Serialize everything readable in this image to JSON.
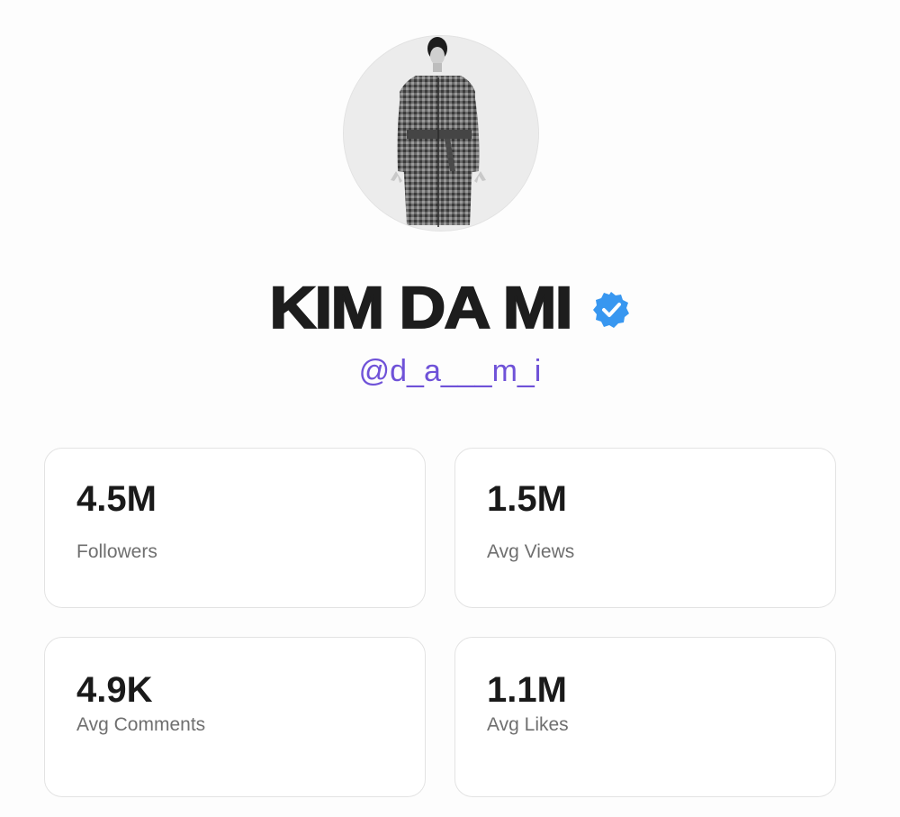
{
  "profile": {
    "name": "KIM DA MI",
    "handle": "@d_a___m_i",
    "verified": true,
    "avatar_icon": "profile-photo",
    "verified_icon": "verified-badge-icon",
    "verified_color": "#3897f0",
    "handle_color": "#6f52d8"
  },
  "stats": [
    {
      "value": "4.5M",
      "label": "Followers"
    },
    {
      "value": "1.5M",
      "label": "Avg Views"
    },
    {
      "value": "4.9K",
      "label": "Avg Comments"
    },
    {
      "value": "1.1M",
      "label": "Avg Likes"
    }
  ]
}
